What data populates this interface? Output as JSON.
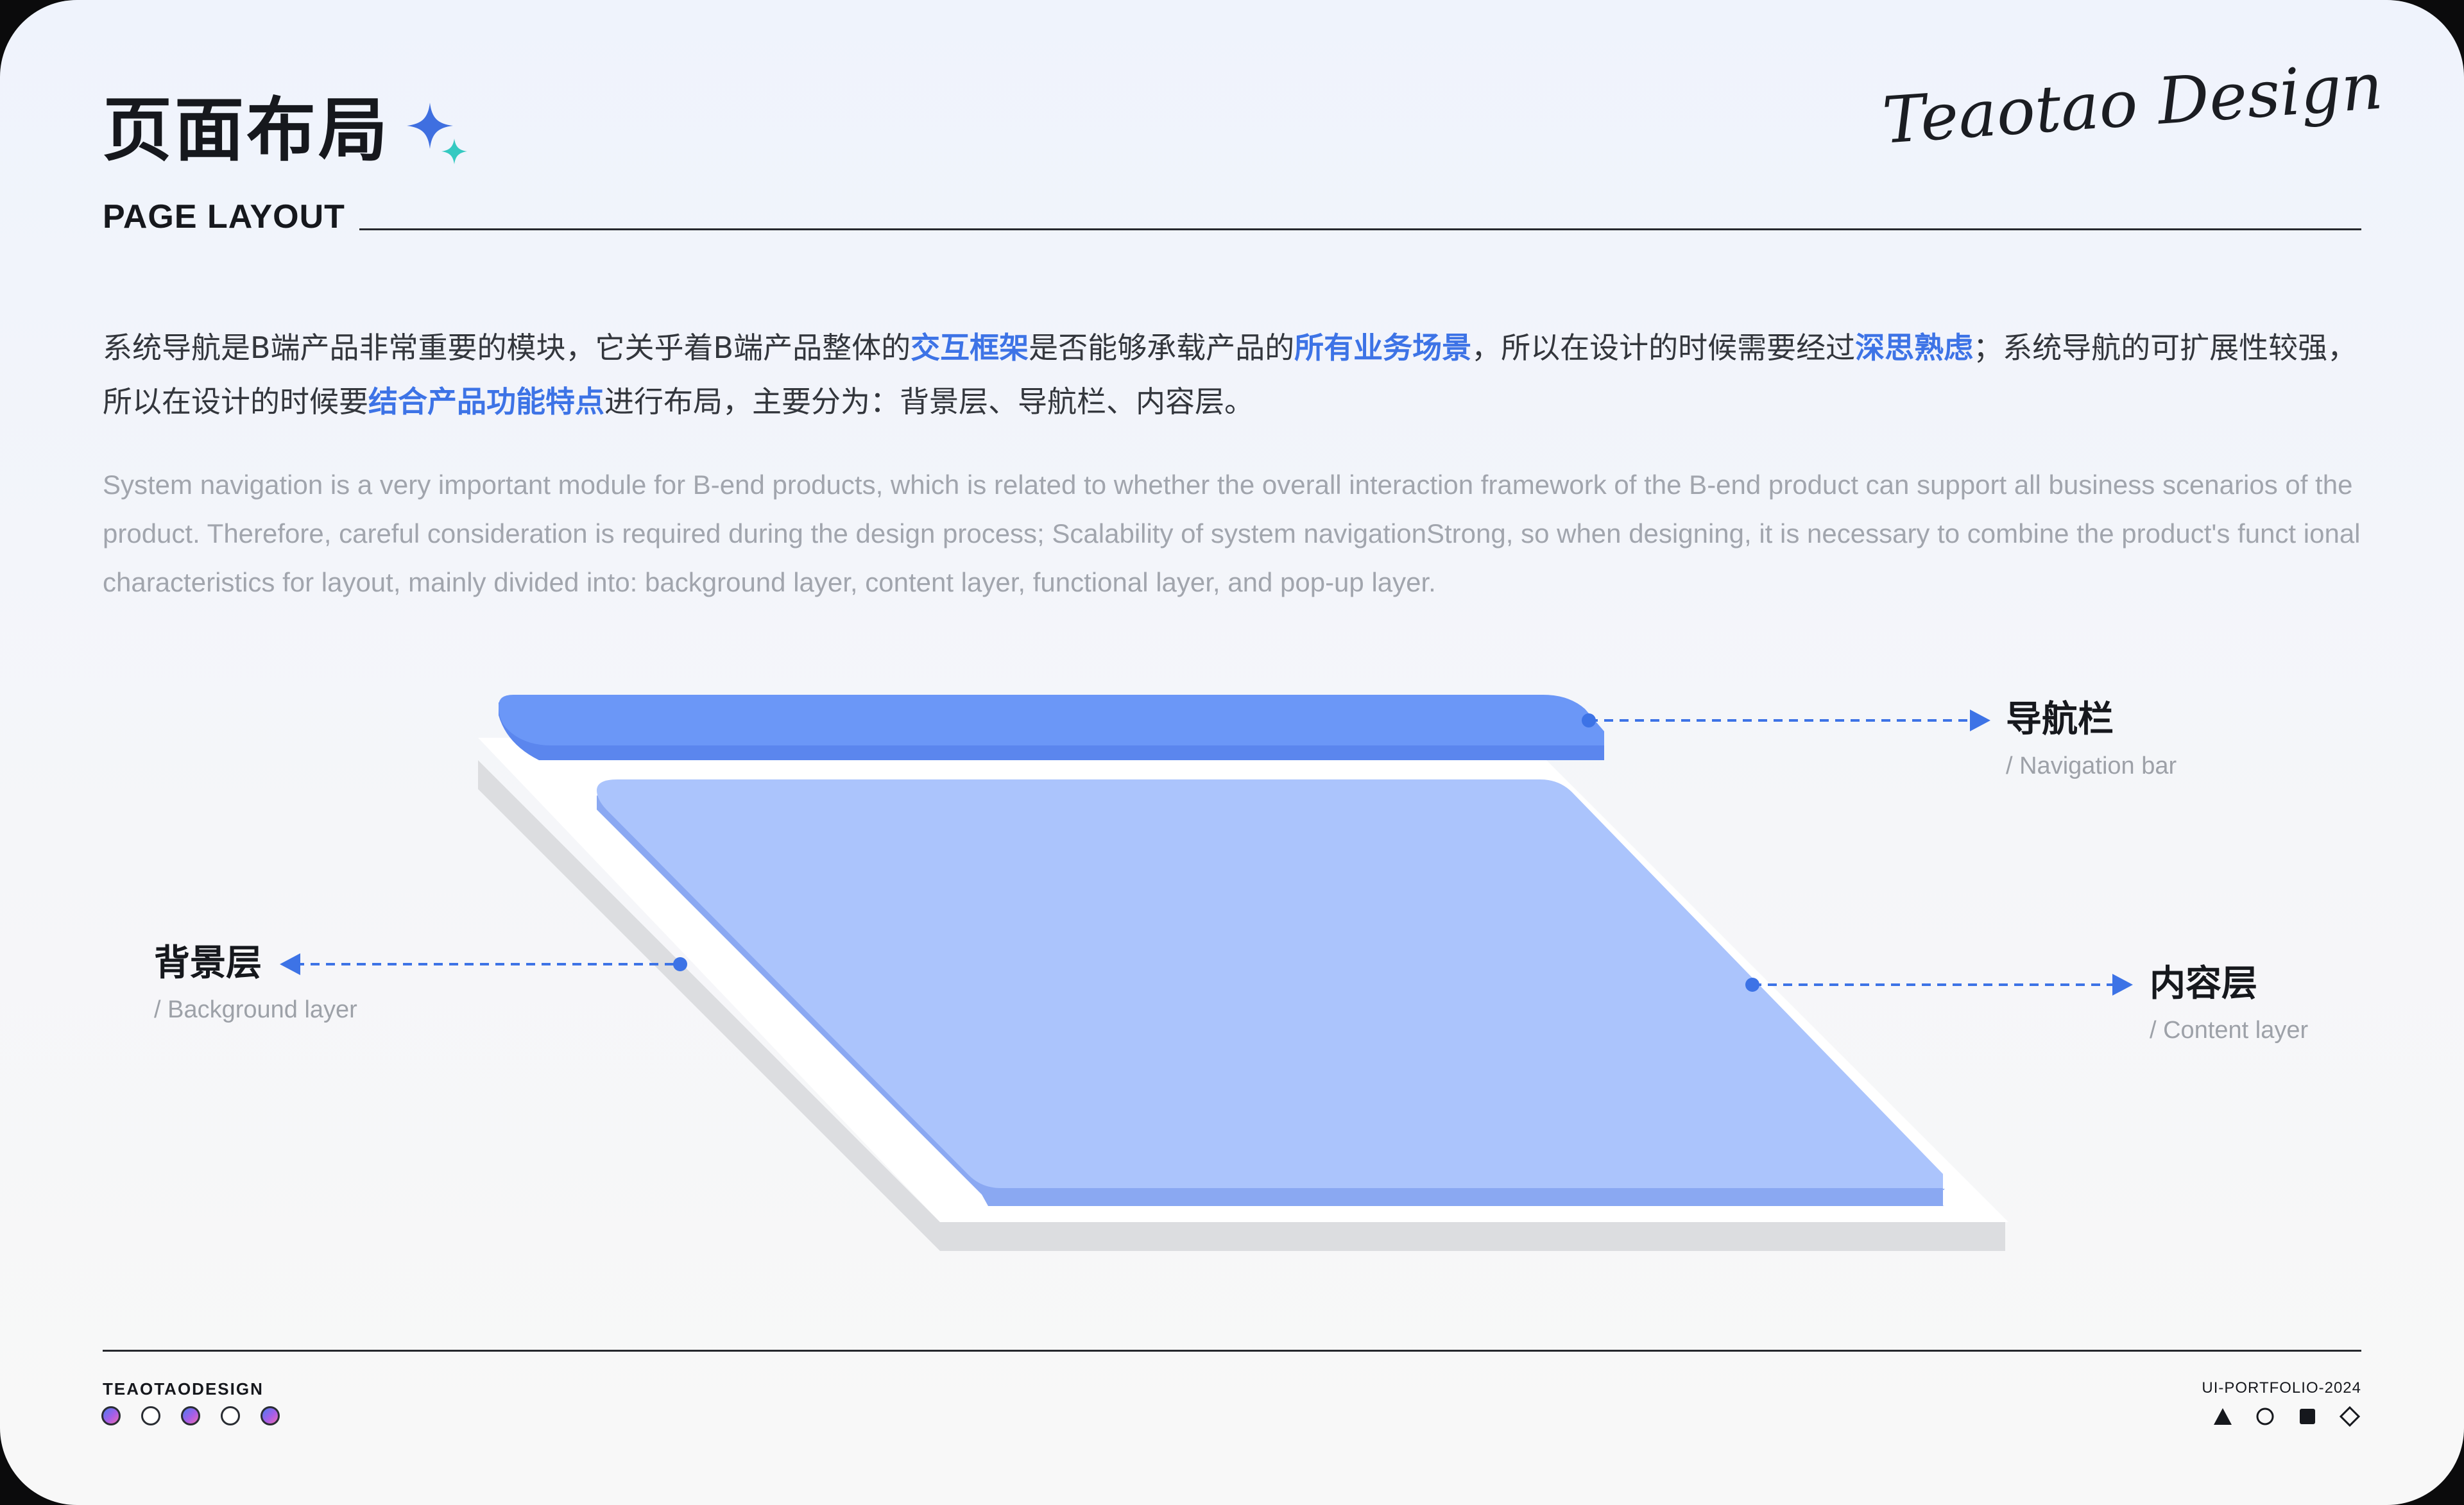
{
  "header": {
    "title_cn": "页面布局",
    "title_en": "PAGE LAYOUT",
    "brand_script": "Teaotao Design"
  },
  "description": {
    "cn": {
      "p1": "系统导航是B端产品非常重要的模块，它关乎着B端产品整体的",
      "h1": "交互框架",
      "p2": "是否能够承载产品的",
      "h2": "所有业务场景",
      "p3": "，所以在设计的时候需要经过",
      "h3": "深思熟虑",
      "p4": "；系统导航的可扩展性较强，所以在设计的时候要",
      "h4": "结合产品功能特点",
      "p5": "进行布局，主要分为：背景层、导航栏、内容层。"
    },
    "en": "System navigation is a very important module for B-end products, which is related to whether the overall interaction framework of the B-end product can support all business scenarios of the product. Therefore, careful consideration is required during the design process; Scalability of system navigationStrong, so when designing, it is necessary to combine the product's funct ional characteristics for layout, mainly divided into: background layer, content layer, functional layer, and pop-up layer."
  },
  "callouts": {
    "nav": {
      "title": "导航栏",
      "subtitle": "/ Navigation bar"
    },
    "background": {
      "title": "背景层",
      "subtitle": "/ Background layer"
    },
    "content": {
      "title": "内容层",
      "subtitle": "/ Content layer"
    }
  },
  "footer": {
    "brand": "TEAOTAODESIGN",
    "portfolio": "UI-PORTFOLIO-2024",
    "dot_icons": [
      "gradient-dot-icon",
      "outline-dot-icon",
      "gradient-dot-icon",
      "outline-dot-icon",
      "gradient-dot-icon"
    ],
    "shape_icons": [
      "triangle-icon",
      "circle-icon",
      "square-icon",
      "diamond-icon"
    ]
  },
  "colors": {
    "accent": "#3d73e6",
    "nav_layer": "#6b97f7",
    "content_layer": "#abc4fc",
    "background_layer": "#ffffff"
  }
}
